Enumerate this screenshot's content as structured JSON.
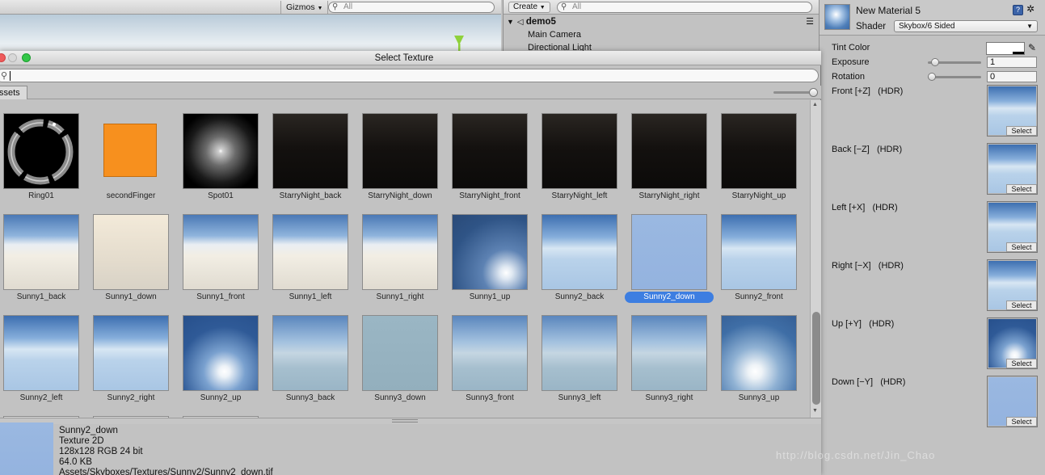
{
  "scene": {
    "gizmos_label": "Gizmos",
    "search_placeholder": "All"
  },
  "hierarchy": {
    "create_label": "Create",
    "search_placeholder": "All",
    "scene_name": "demo5",
    "items": [
      "Main Camera",
      "Directional Light"
    ]
  },
  "inspector": {
    "material_name": "New Material 5",
    "shader_label": "Shader",
    "shader_value": "Skybox/6 Sided",
    "tint_label": "Tint Color",
    "exposure_label": "Exposure",
    "exposure_value": "1",
    "exposure_level": 0.08,
    "rotation_label": "Rotation",
    "rotation_value": "0",
    "rotation_level": 0.0,
    "select_label": "Select",
    "slots": [
      {
        "name": "Front [+Z]",
        "hdr": "(HDR)",
        "tex": "Sunny2_front"
      },
      {
        "name": "Back [−Z]",
        "hdr": "(HDR)",
        "tex": "Sunny2_back"
      },
      {
        "name": "Left [+X]",
        "hdr": "(HDR)",
        "tex": "Sunny2_left"
      },
      {
        "name": "Right [−X]",
        "hdr": "(HDR)",
        "tex": "Sunny2_right"
      },
      {
        "name": "Up [+Y]",
        "hdr": "(HDR)",
        "tex": "Sunny2_up"
      },
      {
        "name": "Down [−Y]",
        "hdr": "(HDR)",
        "tex": "Sunny2_down"
      }
    ]
  },
  "dialog": {
    "title": "Select Texture",
    "tab_label": "ssets",
    "selected": "Sunny2_down",
    "rows": [
      [
        "Ring01",
        "secondFinger",
        "Spot01",
        "StarryNight_back",
        "StarryNight_down",
        "StarryNight_front",
        "StarryNight_left",
        "StarryNight_right",
        "StarryNight_up"
      ],
      [
        "Sunny1_back",
        "Sunny1_down",
        "Sunny1_front",
        "Sunny1_left",
        "Sunny1_right",
        "Sunny1_up",
        "Sunny2_back",
        "Sunny2_down",
        "Sunny2_front"
      ],
      [
        "Sunny2_left",
        "Sunny2_right",
        "Sunny2_up",
        "Sunny3_back",
        "Sunny3_down",
        "Sunny3_front",
        "Sunny3_left",
        "Sunny3_right",
        "Sunny3_up"
      ]
    ]
  },
  "preview": {
    "name": "Sunny2_down",
    "type": "Texture 2D",
    "format": "128x128  RGB 24 bit",
    "size": "64.0 KB",
    "path": "Assets/Skyboxes/Textures/Sunny2/Sunny2_down.tif"
  },
  "watermark": "http://blog.csdn.net/Jin_Chao"
}
